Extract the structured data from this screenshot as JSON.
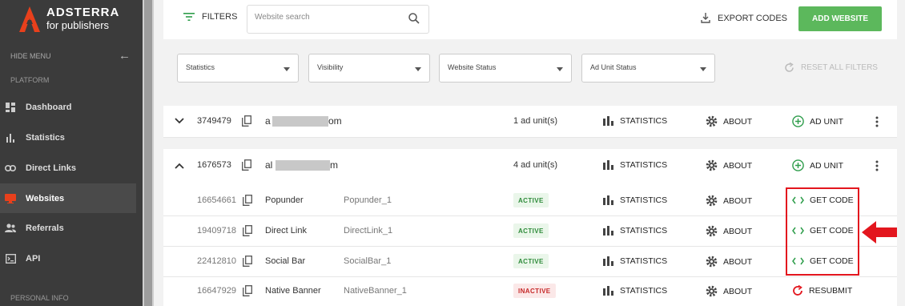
{
  "brand": {
    "name": "ADSTERRA",
    "tagline": "for publishers",
    "color": "#e8401c"
  },
  "sidebar": {
    "hide_menu": "HIDE MENU",
    "platform_label": "PLATFORM",
    "personal_info_label": "PERSONAL INFO",
    "items": [
      {
        "label": "Dashboard",
        "icon": "dashboard-icon"
      },
      {
        "label": "Statistics",
        "icon": "bar-chart-icon"
      },
      {
        "label": "Direct Links",
        "icon": "link-icon"
      },
      {
        "label": "Websites",
        "icon": "monitor-icon",
        "active": true,
        "active_color": "#e8401c"
      },
      {
        "label": "Referrals",
        "icon": "users-icon"
      },
      {
        "label": "API",
        "icon": "terminal-icon"
      }
    ]
  },
  "toolbar": {
    "filters_label": "FILTERS",
    "search_placeholder": "Website search",
    "export_label": "EXPORT CODES",
    "add_label": "ADD WEBSITE",
    "add_color": "#5cb85c"
  },
  "filters": {
    "statistics": "Statistics",
    "visibility": "Visibility",
    "website_status": "Website Status",
    "ad_unit_status": "Ad Unit Status",
    "reset_label": "RESET ALL FILTERS"
  },
  "sites": [
    {
      "id": "3749479",
      "domain_start": "a",
      "domain_end": "om",
      "units": "1 ad unit(s)",
      "statistics": "STATISTICS",
      "about": "ABOUT",
      "add_unit": "AD UNIT",
      "expanded": false
    },
    {
      "id": "1676573",
      "domain_start": "al",
      "domain_end": "m",
      "units": "4 ad unit(s)",
      "statistics": "STATISTICS",
      "about": "ABOUT",
      "add_unit": "AD UNIT",
      "expanded": true
    }
  ],
  "ad_units": [
    {
      "id": "16654661",
      "type": "Popunder",
      "name": "Popunder_1",
      "status": "ACTIVE",
      "statistics": "STATISTICS",
      "about": "ABOUT",
      "action": "GET CODE"
    },
    {
      "id": "19409718",
      "type": "Direct Link",
      "name": "DirectLink_1",
      "status": "ACTIVE",
      "statistics": "STATISTICS",
      "about": "ABOUT",
      "action": "GET CODE"
    },
    {
      "id": "22412810",
      "type": "Social Bar",
      "name": "SocialBar_1",
      "status": "ACTIVE",
      "statistics": "STATISTICS",
      "about": "ABOUT",
      "action": "GET CODE"
    },
    {
      "id": "16647929",
      "type": "Native Banner",
      "name": "NativeBanner_1",
      "status": "INACTIVE",
      "statistics": "STATISTICS",
      "about": "ABOUT",
      "action": "RESUBMIT"
    }
  ],
  "colors": {
    "active": "#2e8b3a",
    "inactive": "#c62828",
    "highlight": "#e3161e"
  }
}
